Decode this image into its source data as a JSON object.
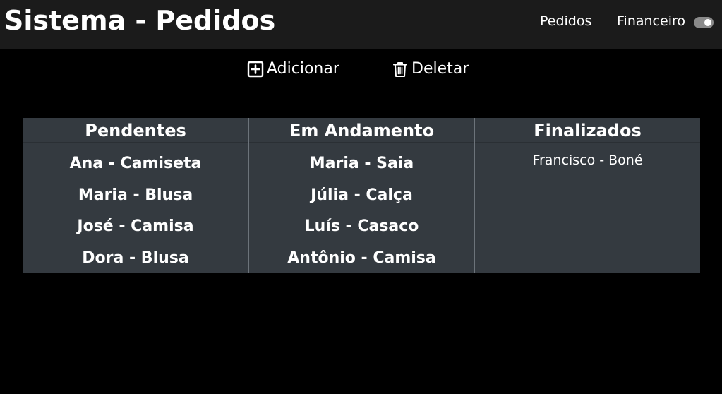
{
  "header": {
    "title": "Sistema - Pedidos",
    "nav": [
      "Pedidos",
      "Financeiro"
    ],
    "toggle_state": "on"
  },
  "actions": {
    "add_label": "Adicionar",
    "add_icon": "plus-square-icon",
    "delete_label": "Deletar",
    "delete_icon": "trash-icon"
  },
  "board": {
    "columns": [
      {
        "title": "Pendentes",
        "items": [
          "Ana - Camiseta",
          "Maria - Blusa",
          "José - Camisa",
          "Dora - Blusa"
        ]
      },
      {
        "title": "Em Andamento",
        "items": [
          "Maria - Saia",
          "Júlia - Calça",
          "Luís - Casaco",
          "Antônio - Camisa"
        ]
      },
      {
        "title": "Finalizados",
        "items": [
          "Francisco - Boné"
        ]
      }
    ]
  },
  "colors": {
    "background": "#000000",
    "navbar": "#1b1b1b",
    "board": "#343a40",
    "text": "#ffffff"
  }
}
